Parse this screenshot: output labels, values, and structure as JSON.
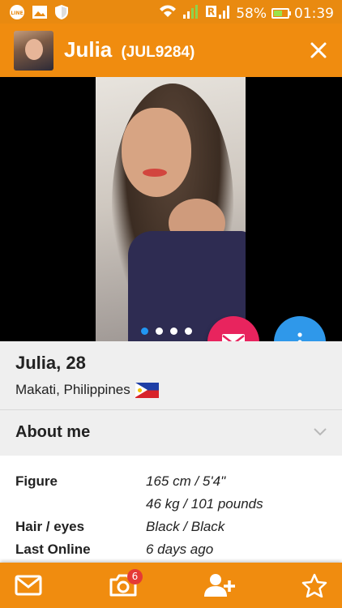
{
  "status_bar": {
    "battery": "58%",
    "time": "01:39",
    "left_icons": [
      "line-app-icon",
      "image-icon",
      "shield-icon"
    ],
    "right_icons": [
      "wifi-icon",
      "signal-icon",
      "roaming-r-icon",
      "battery-icon"
    ]
  },
  "header": {
    "name": "Julia",
    "code": "(JUL9284)",
    "close_icon": "close-icon"
  },
  "photos": {
    "count": 4,
    "active_index": 0
  },
  "profile": {
    "name_age": "Julia, 28",
    "location": "Makati, Philippines",
    "flag": "philippines-flag"
  },
  "about": {
    "title": "About me"
  },
  "details": [
    {
      "label": "Figure",
      "value": "165 cm / 5'4\""
    },
    {
      "label": "",
      "value": "46 kg / 101 pounds"
    },
    {
      "label": "Hair / eyes",
      "value": "Black / Black"
    },
    {
      "label": "Last Online",
      "value": "6 days ago"
    }
  ],
  "bottom_nav": {
    "items": [
      "mail-icon",
      "camera-icon",
      "add-user-icon",
      "star-icon"
    ],
    "camera_badge": "6"
  },
  "colors": {
    "primary": "#f08c0f",
    "mail_fab": "#e8245e",
    "more_fab": "#2f98ea",
    "badge": "#e53935"
  }
}
